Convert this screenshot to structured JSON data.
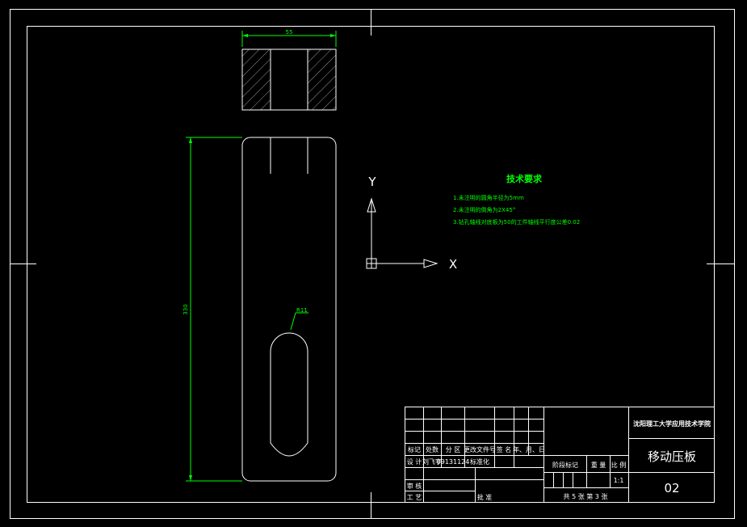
{
  "colors": {
    "background": "#000000",
    "lines": "#ffffff",
    "dimensions": "#00ff00"
  },
  "dimensions": {
    "top_width": "55",
    "height": "330",
    "radius": "R11"
  },
  "axes": {
    "x_label": "X",
    "y_label": "Y"
  },
  "tech_requirements": {
    "title": "技术要求",
    "items": [
      "1.未注明的圆角半径为5mm",
      "2.未注明的倒角为2X45°",
      "3.钻孔轴线对底板为50的工件轴线平行度公差0.02"
    ]
  },
  "title_block": {
    "school": "沈阳理工大学应用技术学院",
    "part_name": "移动压板",
    "drawing_no": "02",
    "scale": "1:1",
    "headers": [
      "标记",
      "处数",
      "分 区",
      "更改文件号",
      "签 名",
      "年、月、日"
    ],
    "design_label": "设 计",
    "designer": "刘飞宇",
    "date": "09131124",
    "standardization": "标准化",
    "review": "审 核",
    "process": "工 艺",
    "approve": "批 准",
    "stage_mark": "阶段标记",
    "weight": "重 量",
    "scale_label": "比 例",
    "sheets": "共 5  张   第  3 张"
  }
}
